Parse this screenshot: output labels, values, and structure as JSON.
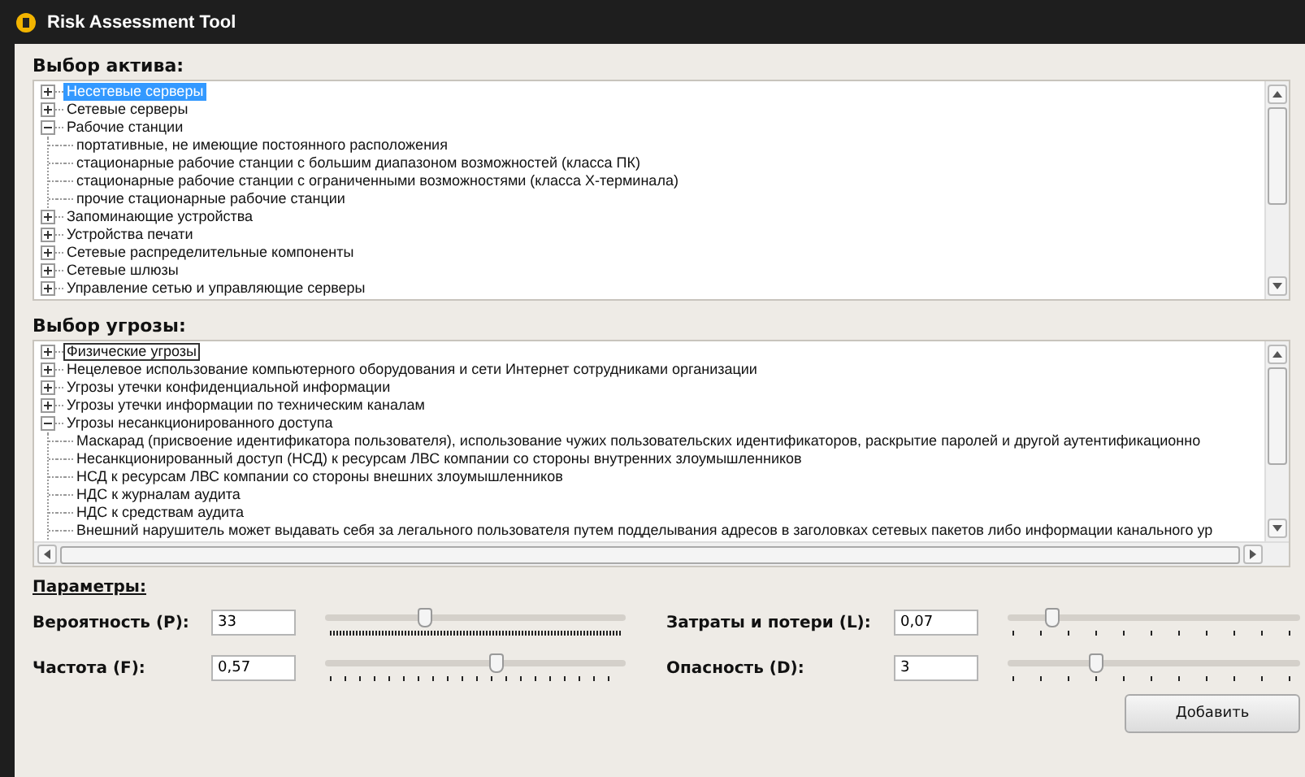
{
  "window": {
    "title": "Risk Assessment Tool"
  },
  "asset_section": {
    "title": "Выбор актива:",
    "tree": {
      "focused": true,
      "items": [
        {
          "label": "Несетевые серверы",
          "expanded": false,
          "selected": true
        },
        {
          "label": "Сетевые серверы",
          "expanded": false,
          "selected": false
        },
        {
          "label": "Рабочие станции",
          "expanded": true,
          "selected": false,
          "children": [
            {
              "label": "портативные, не имеющие постоянного расположения",
              "selected": false
            },
            {
              "label": "стационарные рабочие станции с большим диапазоном возможностей (класса ПК)",
              "selected": false
            },
            {
              "label": "стационарные рабочие станции с ограниченными возможностями (класса X-терминала)",
              "selected": false
            },
            {
              "label": "прочие стационарные рабочие станции",
              "selected": false
            }
          ]
        },
        {
          "label": "Запоминающие устройства",
          "expanded": false,
          "selected": false
        },
        {
          "label": "Устройства печати",
          "expanded": false,
          "selected": false
        },
        {
          "label": "Сетевые распределительные компоненты",
          "expanded": false,
          "selected": false
        },
        {
          "label": "Сетевые шлюзы",
          "expanded": false,
          "selected": false
        },
        {
          "label": "Управление сетью и управляющие серверы",
          "expanded": false,
          "selected": false
        }
      ]
    }
  },
  "threat_section": {
    "title": "Выбор угрозы:",
    "tree": {
      "focused": false,
      "items": [
        {
          "label": "Физические угрозы",
          "expanded": false,
          "selected": true
        },
        {
          "label": "Нецелевое использование компьютерного оборудования и сети Интернет сотрудниками организации",
          "expanded": false,
          "selected": false
        },
        {
          "label": "Угрозы утечки конфиденциальной информации",
          "expanded": false,
          "selected": false
        },
        {
          "label": "Угрозы утечки информации по техническим каналам",
          "expanded": false,
          "selected": false
        },
        {
          "label": "Угрозы несанкционированного доступа",
          "expanded": true,
          "selected": false,
          "children": [
            {
              "label": "Маскарад (присвоение идентификатора пользователя), использование чужих пользовательских идентификаторов, раскрытие паролей и другой аутентификационно",
              "selected": false
            },
            {
              "label": "Несанкционированный доступ (НСД) к ресурсам ЛВС компании со стороны внутренних злоумышленников",
              "selected": false
            },
            {
              "label": "НСД к ресурсам ЛВС компании со стороны внешних злоумышленников",
              "selected": false
            },
            {
              "label": "НДС к журналам аудита",
              "selected": false
            },
            {
              "label": "НДС к средствам аудита",
              "selected": false
            },
            {
              "label": "Внешний нарушитель может выдавать себя за легального пользователя путем подделывания адресов в заголовках сетевых пакетов либо информации канального ур",
              "selected": false
            }
          ]
        }
      ]
    }
  },
  "parameters": {
    "title": "Параметры:",
    "fields": [
      {
        "label": "Вероятность (P):",
        "value": "33",
        "level": 0.33,
        "kind": "dense"
      },
      {
        "label": "Затраты и потери (L):",
        "value": "0,07",
        "level": 0.15,
        "kind": "sparse"
      },
      {
        "label": "Частота (F):",
        "value": "0,57",
        "level": 0.57,
        "kind": "medium"
      },
      {
        "label": "Опасность (D):",
        "value": "3",
        "level": 0.3,
        "kind": "sparse"
      }
    ]
  },
  "add_button": "Добавить"
}
